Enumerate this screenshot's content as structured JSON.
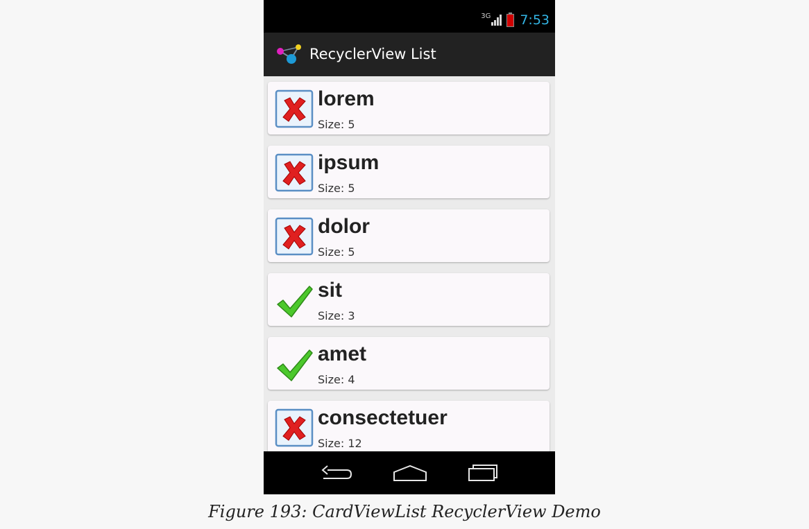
{
  "status_bar": {
    "network_label": "3G",
    "time": "7:53",
    "battery_level": 1.0,
    "colors": {
      "clock": "#33b5e5",
      "battery": "#d00000"
    }
  },
  "action_bar": {
    "logo_icon": "app-logo-icon",
    "title": "RecyclerView List"
  },
  "items": [
    {
      "word": "lorem",
      "size": "Size: 5",
      "icon": "red-x-icon"
    },
    {
      "word": "ipsum",
      "size": "Size: 5",
      "icon": "red-x-icon"
    },
    {
      "word": "dolor",
      "size": "Size: 5",
      "icon": "red-x-icon"
    },
    {
      "word": "sit",
      "size": "Size: 3",
      "icon": "green-check-icon"
    },
    {
      "word": "amet",
      "size": "Size: 4",
      "icon": "green-check-icon"
    },
    {
      "word": "consectetuer",
      "size": "Size: 12",
      "icon": "red-x-icon"
    }
  ],
  "nav_bar": {
    "buttons": [
      "back-icon",
      "home-icon",
      "recents-icon"
    ]
  },
  "caption": "Figure 193: CardViewList RecyclerView Demo"
}
